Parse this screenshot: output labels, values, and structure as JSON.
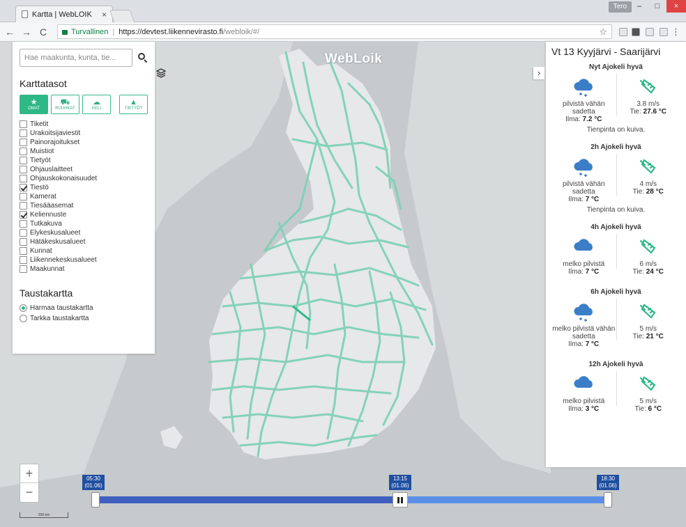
{
  "browser": {
    "tab_title": "Kartta | WebLOIK",
    "tab_close": "×",
    "user_label": "Tero",
    "secure_label": "Turvallinen",
    "url_host": "https://devtest.liikennevirasto.fi",
    "url_path": "/webloik/#/",
    "nav_back": "←",
    "nav_forward": "→",
    "nav_reload": "C",
    "win_min": "–",
    "win_max": "□",
    "win_close": "×",
    "star": "☆",
    "menu": "⋮"
  },
  "map": {
    "logo": "WebLoik"
  },
  "left_panel": {
    "search_placeholder": "Hae maakunta, kunta, tie...",
    "layers_title": "Karttatasot",
    "layer_buttons": [
      {
        "label": "OMAT",
        "icon": "★",
        "active": true
      },
      {
        "label": "RUUHKAT",
        "icon": "⛟",
        "active": false
      },
      {
        "label": "KELI",
        "icon": "☁",
        "active": false
      },
      {
        "label": "TIETYÖT",
        "icon": "▲",
        "active": false
      }
    ],
    "layers": [
      {
        "label": "Tiketit",
        "checked": false
      },
      {
        "label": "Urakoitsijaviestit",
        "checked": false
      },
      {
        "label": "Painorajoitukset",
        "checked": false
      },
      {
        "label": "Muistiot",
        "checked": false
      },
      {
        "label": "Tietyöt",
        "checked": false
      },
      {
        "label": "Ohjauslaitteet",
        "checked": false
      },
      {
        "label": "Ohjauskokonaisuudet",
        "checked": false
      },
      {
        "label": "Tiestö",
        "checked": true
      },
      {
        "label": "Kamerat",
        "checked": false
      },
      {
        "label": "Tiesääasemat",
        "checked": false
      },
      {
        "label": "Keliennuste",
        "checked": true
      },
      {
        "label": "Tutkakuva",
        "checked": false
      },
      {
        "label": "Elykeskusalueet",
        "checked": false
      },
      {
        "label": "Hätäkeskusalueet",
        "checked": false
      },
      {
        "label": "Kunnat",
        "checked": false
      },
      {
        "label": "Liikennekeskusalueet",
        "checked": false
      },
      {
        "label": "Maakunnat",
        "checked": false
      }
    ],
    "background_title": "Taustakartta",
    "backgrounds": [
      {
        "label": "Harmaa taustakartta",
        "selected": true
      },
      {
        "label": "Tarkka taustakartta",
        "selected": false
      }
    ]
  },
  "right_panel": {
    "collapse_icon": "›",
    "title": "Vt 13 Kyyjärvi - Saarijärvi",
    "forecasts": [
      {
        "heading": "Nyt Ajokeli hyvä",
        "weather": "pilvistä vähän sadetta",
        "weather_icon": "cloud-rain-icon",
        "air_label": "Ilma:",
        "air_temp": "7.2 °C",
        "wind": "3.8 m/s",
        "road_label": "Tie:",
        "road_temp": "27.6 °C",
        "note": "Tienpinta on kuiva."
      },
      {
        "heading": "2h Ajokeli hyvä",
        "weather": "pilvistä vähän sadetta",
        "weather_icon": "cloud-rain-icon",
        "air_label": "Ilma:",
        "air_temp": "7 °C",
        "wind": "4 m/s",
        "road_label": "Tie:",
        "road_temp": "28 °C",
        "note": "Tienpinta on kuiva."
      },
      {
        "heading": "4h Ajokeli hyvä",
        "weather": "melko pilvistä",
        "weather_icon": "cloud-icon",
        "air_label": "Ilma:",
        "air_temp": "7 °C",
        "wind": "6 m/s",
        "road_label": "Tie:",
        "road_temp": "24 °C",
        "note": ""
      },
      {
        "heading": "6h Ajokeli hyvä",
        "weather": "melko pilvistä vähän sadetta",
        "weather_icon": "cloud-rain-icon",
        "air_label": "Ilma:",
        "air_temp": "7 °C",
        "wind": "5 m/s",
        "road_label": "Tie:",
        "road_temp": "21 °C",
        "note": ""
      },
      {
        "heading": "12h Ajokeli hyvä",
        "weather": "melko pilvistä",
        "weather_icon": "cloud-icon",
        "air_label": "Ilma:",
        "air_temp": "3 °C",
        "wind": "5 m/s",
        "road_label": "Tie:",
        "road_temp": "6 °C",
        "note": ""
      }
    ]
  },
  "controls": {
    "zoom_in": "+",
    "zoom_out": "−",
    "scale_label": "200 km"
  },
  "timeline": {
    "start_time": "05:30",
    "start_date": "(01.06)",
    "current_time": "13:15",
    "current_date": "(01.06)",
    "end_time": "18:30",
    "end_date": "(01.06)"
  },
  "colors": {
    "accent": "#2eb886",
    "road": "#7fd1b5",
    "timeline_past": "#3f5fbf",
    "timeline_future": "#5b8fe6",
    "timeline_label": "#1f4fa0"
  }
}
